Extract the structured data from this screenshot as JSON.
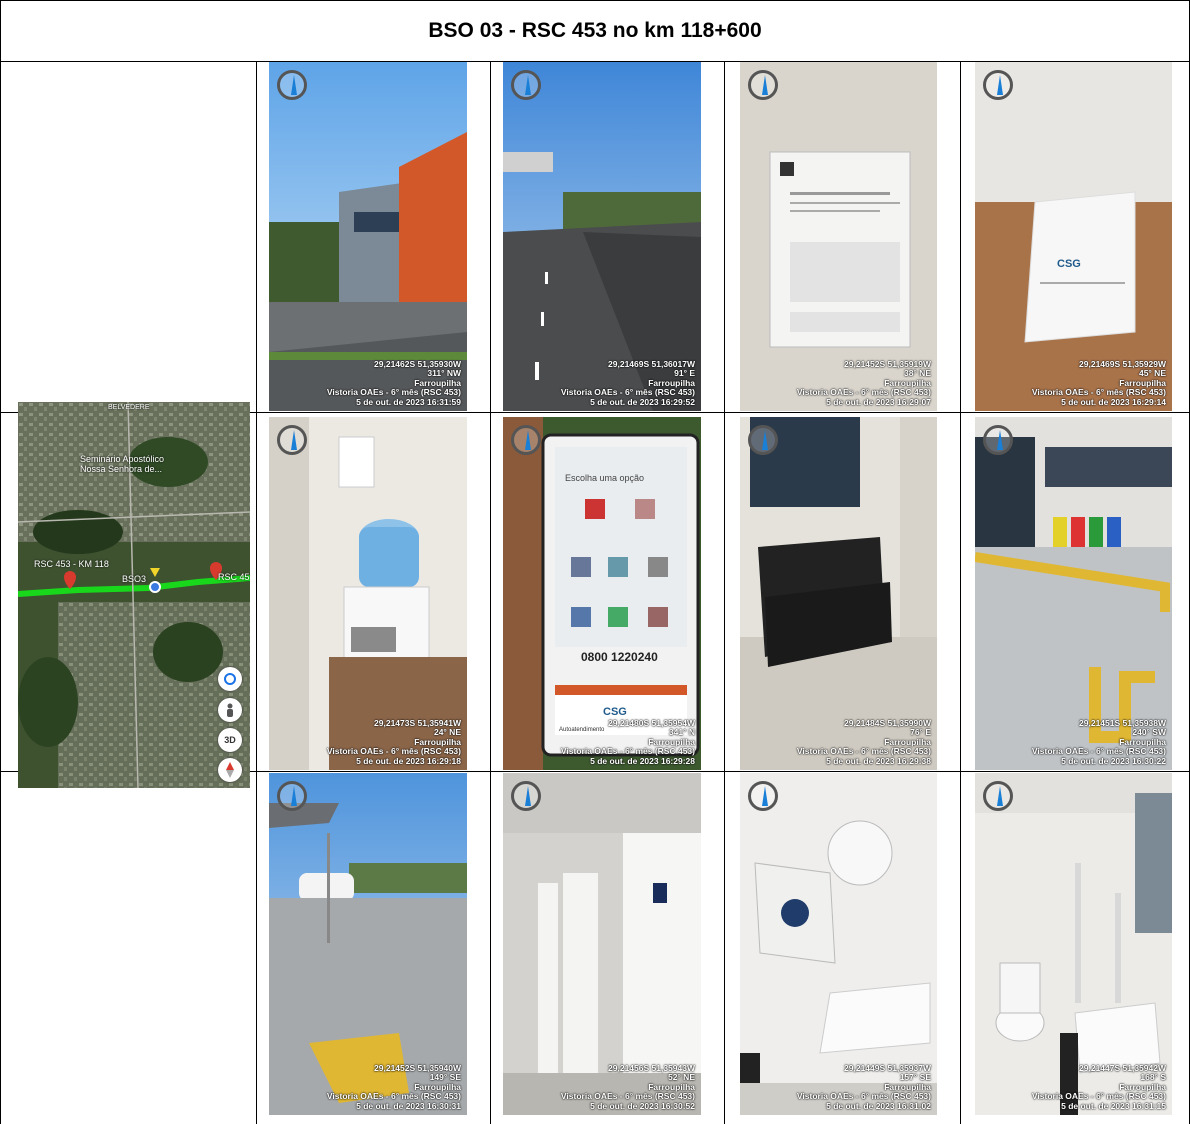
{
  "title": "BSO 03 - RSC 453 no km 118+600",
  "map": {
    "labels": {
      "belvedere": "BELVEDERE",
      "seminario": "Seminário Apostólico\nNossa Senhora de...",
      "rsc_left": "RSC 453 - KM 118",
      "bso": "BSO3",
      "rsc_right": "RSC 45",
      "btn_3d": "3D"
    },
    "icons": [
      "location-target-icon",
      "pegman-icon",
      "compass-icon"
    ]
  },
  "photos": [
    {
      "coords": "29,21462S 51,35930W",
      "heading": "311° NW",
      "city": "Farroupilha",
      "survey": "Vistoria OAEs - 6° mês (RSC 453)",
      "date": "5 de out. de 2023 16:31:59"
    },
    {
      "coords": "29,21469S 51,36017W",
      "heading": "91° E",
      "city": "Farroupilha",
      "survey": "Vistoria OAEs - 6° mês (RSC 453)",
      "date": "5 de out. de 2023 16:29:52"
    },
    {
      "coords": "29,21452S 51,35919W",
      "heading": "38° NE",
      "city": "Farroupilha",
      "survey": "Vistoria OAEs - 6° mês (RSC 453)",
      "date": "5 de out. de 2023 16:29:07"
    },
    {
      "coords": "29,21469S 51,35929W",
      "heading": "45° NE",
      "city": "Farroupilha",
      "survey": "Vistoria OAEs - 6° mês (RSC 453)",
      "date": "5 de out. de 2023 16:29:14"
    },
    {
      "coords": "29,21473S 51,35941W",
      "heading": "24° NE",
      "city": "Farroupilha",
      "survey": "Vistoria OAEs - 6° mês (RSC 453)",
      "date": "5 de out. de 2023 16:29:18"
    },
    {
      "coords": "29,21480S 51,35954W",
      "heading": "341° N",
      "city": "Farroupilha",
      "survey": "Vistoria OAEs - 6° mês (RSC 453)",
      "date": "5 de out. de 2023 16:29:28"
    },
    {
      "coords": "29,21484S 51,35990W",
      "heading": "76° E",
      "city": "Farroupilha",
      "survey": "Vistoria OAEs - 6° mês (RSC 453)",
      "date": "5 de out. de 2023 16:29:38"
    },
    {
      "coords": "29,21451S 51,35938W",
      "heading": "240° SW",
      "city": "Farroupilha",
      "survey": "Vistoria OAEs - 6° mês (RSC 453)",
      "date": "5 de out. de 2023 16:30:22"
    },
    {
      "coords": "29,21452S 51,35940W",
      "heading": "149° SE",
      "city": "Farroupilha",
      "survey": "Vistoria OAEs - 6° mês (RSC 453)",
      "date": "5 de out. de 2023 16:30:31"
    },
    {
      "coords": "29,21456S 51,35943W",
      "heading": "52° NE",
      "city": "Farroupilha",
      "survey": "Vistoria OAEs - 6° mês (RSC 453)",
      "date": "5 de out. de 2023 16:30:52"
    },
    {
      "coords": "29,21449S 51,35937W",
      "heading": "157° SE",
      "city": "Farroupilha",
      "survey": "Vistoria OAEs - 6° mês (RSC 453)",
      "date": "5 de out. de 2023 16:31:02"
    },
    {
      "coords": "29,21447S 51,35942W",
      "heading": "168° S",
      "city": "Farroupilha",
      "survey": "Vistoria OAEs - 6° mês (RSC 453)",
      "date": "5 de out. de 2023 16:31:15"
    }
  ],
  "photo_content": {
    "logo": "CSG",
    "kiosk_title": "Escolha uma opção",
    "kiosk_phone": "0800 1220240",
    "kiosk_footer": "Autoatendimento"
  },
  "colors": {
    "facade_orange": "#d2582a",
    "map_route": "#19d81c",
    "tactile_yellow": "#e0b733",
    "sky_blue": "#8fc4ef"
  }
}
